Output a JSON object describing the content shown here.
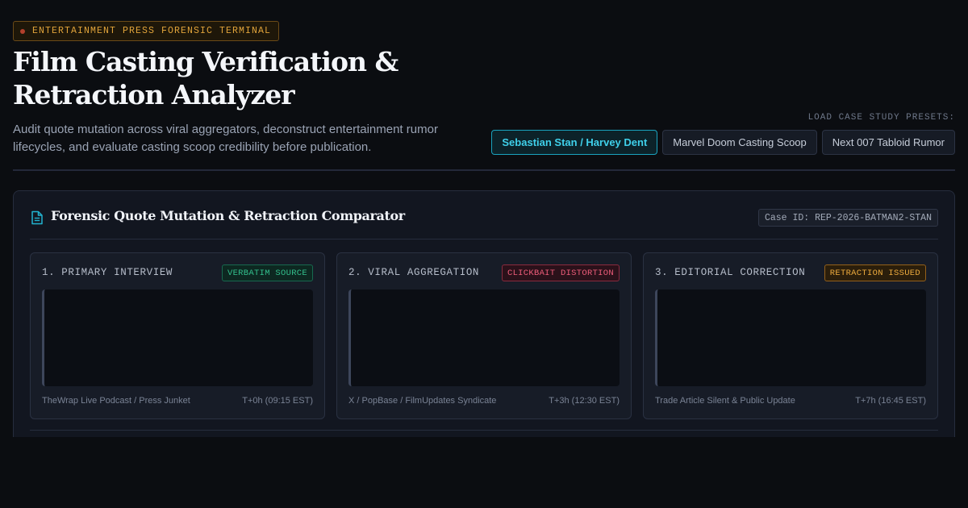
{
  "header": {
    "badge": "ENTERTAINMENT PRESS FORENSIC TERMINAL",
    "title": "Film Casting Verification & Retraction Analyzer",
    "subtitle": "Audit quote mutation across viral aggregators, deconstruct entertainment rumor lifecycles, and evaluate casting scoop credibility before publication.",
    "presets_label": "LOAD CASE STUDY PRESETS:",
    "presets": [
      {
        "label": "Sebastian Stan / Harvey Dent",
        "active": true
      },
      {
        "label": "Marvel Doom Casting Scoop",
        "active": false
      },
      {
        "label": "Next 007 Tabloid Rumor",
        "active": false
      }
    ]
  },
  "panel": {
    "title": "Forensic Quote Mutation & Retraction Comparator",
    "case_id": "Case ID: REP-2026-BATMAN2-STAN",
    "cards": [
      {
        "heading": "1. PRIMARY INTERVIEW",
        "badge": "VERBATIM SOURCE",
        "source": "TheWrap Live Podcast / Press Junket",
        "time": "T+0h (09:15 EST)"
      },
      {
        "heading": "2. VIRAL AGGREGATION",
        "badge": "CLICKBAIT DISTORTION",
        "source": "X / PopBase / FilmUpdates Syndicate",
        "time": "T+3h (12:30 EST)"
      },
      {
        "heading": "3. EDITORIAL CORRECTION",
        "badge": "RETRACTION ISSUED",
        "source": "Trade Article Silent & Public Update",
        "time": "T+7h (16:45 EST)"
      }
    ]
  },
  "colors": {
    "background": "#0b0d11",
    "accent": "#3fd0ea",
    "verbatim": "#33c08d",
    "clickbait": "#ee5d7a",
    "retraction": "#efac3e"
  }
}
